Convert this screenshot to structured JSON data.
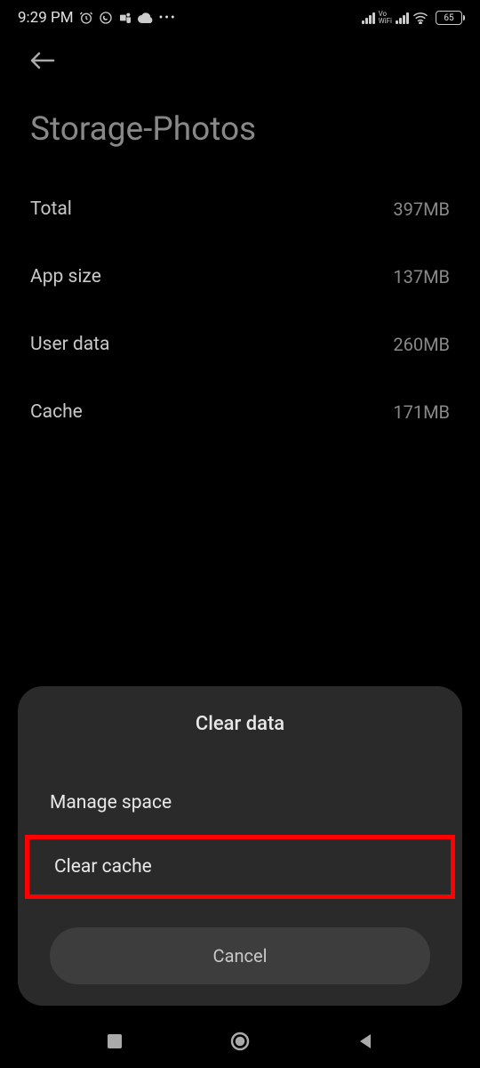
{
  "status": {
    "time": "9:29 PM",
    "battery": "65"
  },
  "page": {
    "title": "Storage-Photos"
  },
  "storage": {
    "rows": [
      {
        "label": "Total",
        "value": "397MB"
      },
      {
        "label": "App size",
        "value": "137MB"
      },
      {
        "label": "User data",
        "value": "260MB"
      },
      {
        "label": "Cache",
        "value": "171MB"
      }
    ]
  },
  "dialog": {
    "title": "Clear data",
    "options": {
      "manage_space": "Manage space",
      "clear_cache": "Clear cache"
    },
    "cancel": "Cancel"
  }
}
